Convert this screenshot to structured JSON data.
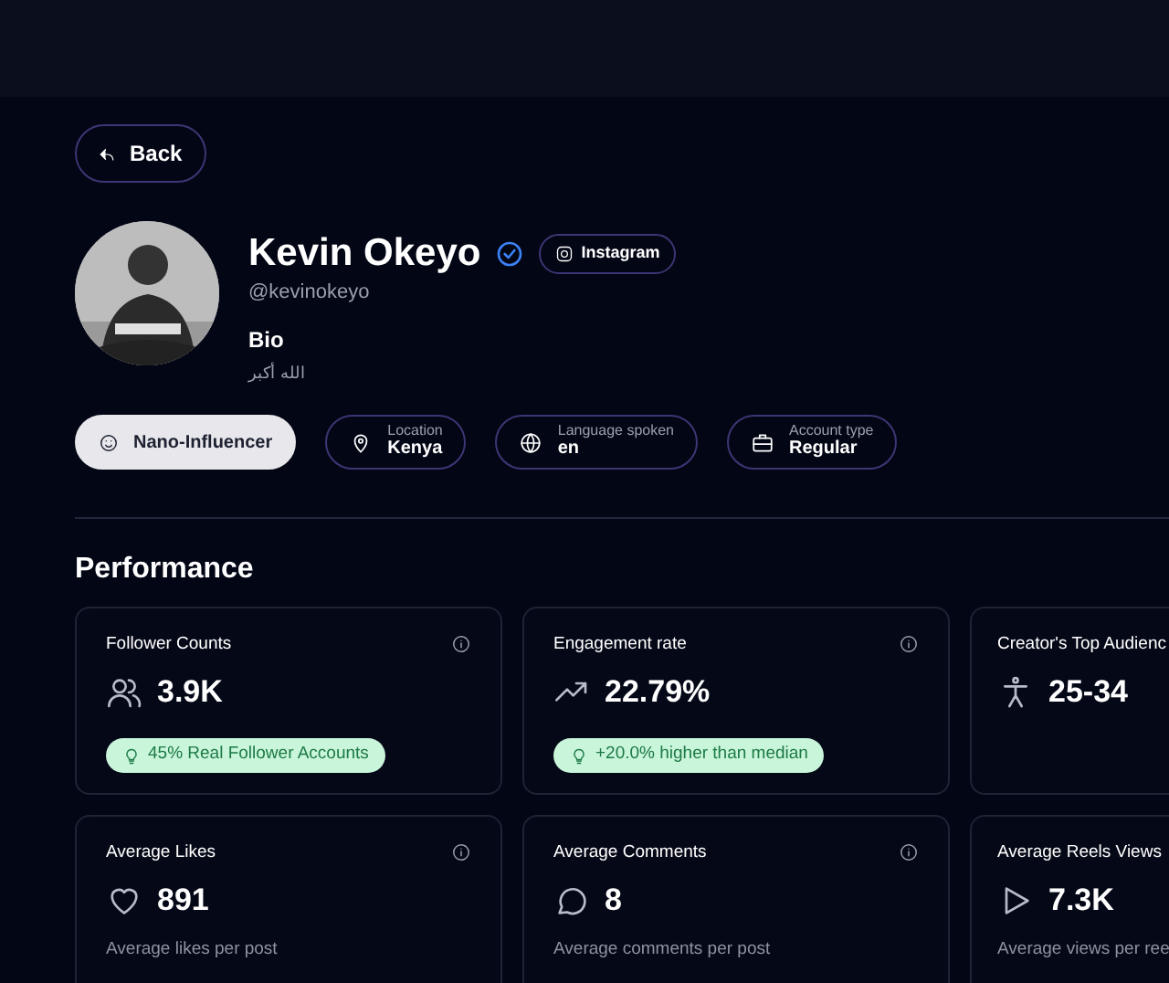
{
  "back_button": {
    "label": "Back"
  },
  "profile": {
    "name": "Kevin Okeyo",
    "verified": true,
    "platform": "Instagram",
    "handle": "@kevinokeyo",
    "bio_heading": "Bio",
    "bio": "الله أكبر"
  },
  "chips": [
    {
      "kind": "tier",
      "value": "Nano-Influencer"
    },
    {
      "kind": "info",
      "label": "Location",
      "value": "Kenya"
    },
    {
      "kind": "info",
      "label": "Language spoken",
      "value": "en"
    },
    {
      "kind": "info",
      "label": "Account type",
      "value": "Regular"
    }
  ],
  "performance": {
    "title": "Performance",
    "metrics": [
      {
        "title": "Follower Counts",
        "value": "3.9K",
        "info": true,
        "kind": "highlight",
        "note": "45% Real Follower Accounts"
      },
      {
        "title": "Engagement rate",
        "value": "22.79%",
        "info": true,
        "kind": "highlight",
        "note": "+20.0% higher than median"
      },
      {
        "title": "Creator's Top Audienc",
        "value": "25-34",
        "kind": "plain"
      },
      {
        "title": "Average Likes",
        "value": "891",
        "info": true,
        "kind": "subtitle",
        "note": "Average likes per post"
      },
      {
        "title": "Average Comments",
        "value": "8",
        "info": true,
        "kind": "subtitle",
        "note": "Average comments per post"
      },
      {
        "title": "Average Reels Views",
        "value": "7.3K",
        "kind": "subtitle",
        "note": "Average views per ree"
      }
    ]
  }
}
